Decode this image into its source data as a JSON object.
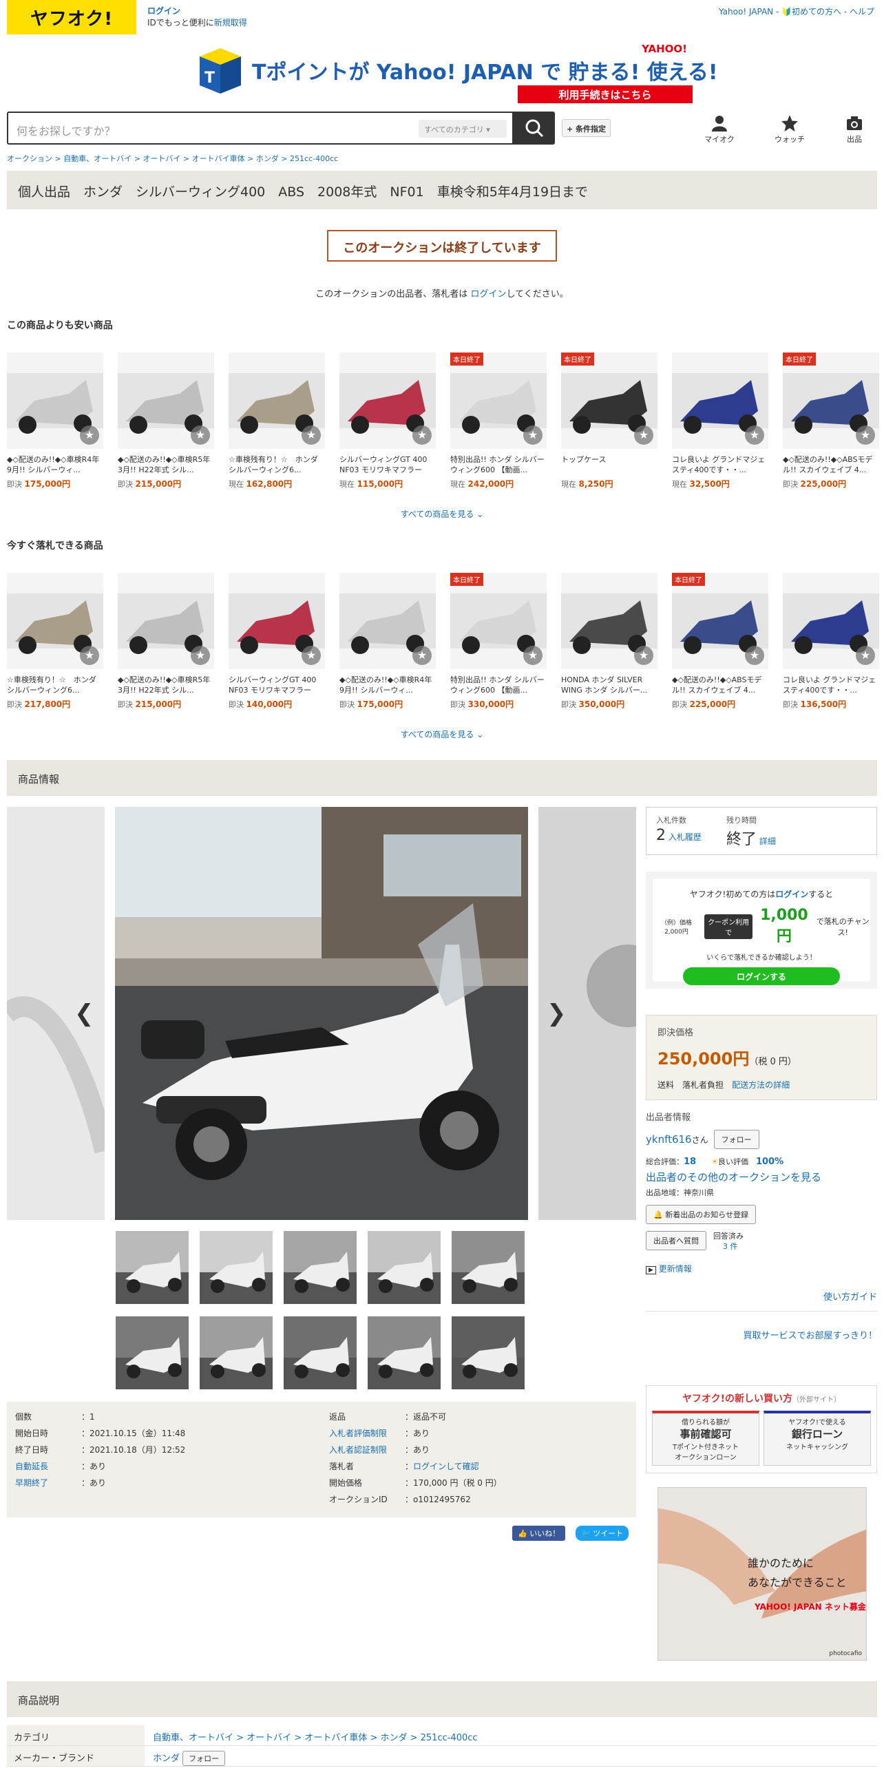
{
  "header": {
    "logo": "ヤフオク!",
    "login": "ログイン",
    "login_sub": "IDでもっと便利に",
    "register": "新規取得",
    "toplinks": "Yahoo! JAPAN - 🔰初めての方へ - ヘルプ",
    "banner_main": "Tポイントが Yahoo! JAPAN で 貯まる! 使える!",
    "banner_sub": "利用手続きはこちら",
    "banner_yahoo": "YAHOO!",
    "search_placeholder": "何をお探しですか？",
    "category_select": "すべてのカテゴリ",
    "conditions": "+ 条件指定",
    "icons": [
      {
        "label": "マイオク"
      },
      {
        "label": "ウォッチ"
      },
      {
        "label": "出品"
      }
    ]
  },
  "breadcrumb": "オークション > 自動車、オートバイ > オートバイ > オートバイ車体 > ホンダ > 251cc-400cc",
  "title": "個人出品　ホンダ　シルバーウィング400　ABS　2008年式　NF01　車検令和5年4月19日まで",
  "ended_notice": "このオークションは終了しています",
  "ended_note_pre": "このオークションの出品者、落札者は",
  "ended_note_link": "ログイン",
  "ended_note_post": "してください。",
  "cheaper": {
    "heading": "この商品よりも安い商品",
    "see_all": "すべての商品を見る",
    "items": [
      {
        "badge": "",
        "title": "◆◇配送のみ!!◆◇車検R4年9月!! シルバーウィ...",
        "ptype": "即決",
        "price": "175,000円",
        "color": "#c9c9c9"
      },
      {
        "badge": "",
        "title": "◆◇配送のみ!!◆◇車検R5年3月!! H22年式 シル...",
        "ptype": "即決",
        "price": "215,000円",
        "color": "#bfbfbf"
      },
      {
        "badge": "",
        "title": "☆車検残有り！☆　ホンダ　シルバーウィング6...",
        "ptype": "現在",
        "price": "162,800円",
        "color": "#a89e8a"
      },
      {
        "badge": "",
        "title": "シルバーウィングGT 400 NF03 モリワキマフラー",
        "ptype": "現在",
        "price": "115,000円",
        "color": "#b8344a"
      },
      {
        "badge": "本日終了",
        "title": "特別出品!! ホンダ シルバーウィング600 【動画...",
        "ptype": "現在",
        "price": "242,000円",
        "color": "#d6d6d6"
      },
      {
        "badge": "本日終了",
        "title": "トップケース",
        "ptype": "現在",
        "price": "8,250円",
        "color": "#333333"
      },
      {
        "badge": "",
        "title": "コレ良いよ グランドマジェスティ400です・・...",
        "ptype": "現在",
        "price": "32,500円",
        "color": "#2e3c8f"
      },
      {
        "badge": "本日終了",
        "title": "◆◇配送のみ!!◆◇ABSモデル!! スカイウェイブ 4...",
        "ptype": "即決",
        "price": "225,000円",
        "color": "#3a4c8c"
      }
    ]
  },
  "buynow": {
    "heading": "今すぐ落札できる商品",
    "see_all": "すべての商品を見る",
    "items": [
      {
        "badge": "",
        "title": "☆車検残有り！☆　ホンダ　シルバーウィング6...",
        "ptype": "即決",
        "price": "217,800円",
        "color": "#a89e8a"
      },
      {
        "badge": "",
        "title": "◆◇配送のみ!!◆◇車検R5年3月!! H22年式 シル...",
        "ptype": "即決",
        "price": "215,000円",
        "color": "#bfbfbf"
      },
      {
        "badge": "",
        "title": "シルバーウィングGT 400 NF03 モリワキマフラー",
        "ptype": "即決",
        "price": "140,000円",
        "color": "#b8344a"
      },
      {
        "badge": "",
        "title": "◆◇配送のみ!!◆◇車検R4年9月!! シルバーウィ...",
        "ptype": "即決",
        "price": "175,000円",
        "color": "#c9c9c9"
      },
      {
        "badge": "本日終了",
        "title": "特別出品!! ホンダ シルバーウィング600 【動画...",
        "ptype": "即決",
        "price": "330,000円",
        "color": "#d6d6d6"
      },
      {
        "badge": "",
        "title": "HONDA ホンダ SILVER WING ホンダ シルバー...",
        "ptype": "即決",
        "price": "350,000円",
        "color": "#4a4a4a"
      },
      {
        "badge": "本日終了",
        "title": "◆◇配送のみ!!◆◇ABSモデル!! スカイウェイブ 4...",
        "ptype": "即決",
        "price": "225,000円",
        "color": "#3a4c8c"
      },
      {
        "badge": "",
        "title": "コレ良いよ グランドマジェスティ400です・・...",
        "ptype": "即決",
        "price": "136,500円",
        "color": "#2e3c8f"
      }
    ]
  },
  "item_info_heading": "商品情報",
  "bid": {
    "count_label": "入札件数",
    "count": "2",
    "history": "入札履歴",
    "time_label": "残り時間",
    "time": "終了",
    "detail": "詳細"
  },
  "promo": {
    "line1": "ヤフオク!初めての方は",
    "login": "ログイン",
    "line1b": "すると",
    "example": "（例）価格2,000円",
    "coupon": "クーポン利用で",
    "amount": "1,000円",
    "chance": "で落札のチャンス!",
    "confirm": "いくらで落札できるか確認しよう！",
    "button": "ログインする"
  },
  "price": {
    "label": "即決価格",
    "value": "250,000円",
    "tax": "（税 0 円）",
    "ship_label": "送料",
    "ship": "落札者負担",
    "ship_link": "配送方法の詳細"
  },
  "seller": {
    "heading": "出品者情報",
    "name": "yknft616",
    "san": "さん",
    "follow": "フォロー",
    "rating_label": "総合評価：",
    "rating": "18",
    "good_label": "良い評価",
    "good": "100%",
    "other": "出品者のその他のオークションを見る",
    "region": "出品地域：神奈川県",
    "notify": "新着出品のお知らせ登録",
    "question": "出品者へ質問",
    "answered": "回答済み",
    "answered_count": "3 件",
    "update": "更新情報",
    "guide": "使い方ガイド",
    "service": "買取サービスでお部屋すっきり！"
  },
  "details_left": [
    {
      "k": "個数",
      "v": "1",
      "link": false
    },
    {
      "k": "開始日時",
      "v": "2021.10.15（金）11:48",
      "link": false
    },
    {
      "k": "終了日時",
      "v": "2021.10.18（月）12:52",
      "link": false
    },
    {
      "k": "自動延長",
      "v": "あり",
      "link": true
    },
    {
      "k": "早期終了",
      "v": "あり",
      "link": true
    }
  ],
  "details_right": [
    {
      "k": "返品",
      "v": "返品不可",
      "link": false,
      "vlink": false
    },
    {
      "k": "入札者評価制限",
      "v": "あり",
      "link": true,
      "vlink": false
    },
    {
      "k": "入札者認証制限",
      "v": "あり",
      "link": true,
      "vlink": false
    },
    {
      "k": "落札者",
      "v": "ログインして確認",
      "link": false,
      "vlink": true
    },
    {
      "k": "開始価格",
      "v": "170,000 円（税 0 円）",
      "link": false,
      "vlink": false
    },
    {
      "k": "オークションID",
      "v": "o1012495762",
      "link": false,
      "vlink": false
    }
  ],
  "social": {
    "like": "いいね！",
    "tweet": "ツイート"
  },
  "newbuy": {
    "title": "ヤフオク!の新しい買い方",
    "ext": "（外部サイト）",
    "c1a": "借りられる額が",
    "c1b": "事前確認可",
    "c1c": "Tポイント付きネット",
    "c1d": "オークションローン",
    "c2a": "ヤフオク!で使える",
    "c2b": "銀行ローン",
    "c2c": "ネットキャッシング"
  },
  "ad": {
    "line1": "誰かのために",
    "line2": "あなたができること",
    "brand": "YAHOO! JAPAN ネット募金",
    "credit": "photocafio"
  },
  "desc_heading": "商品説明",
  "desc_rows": [
    {
      "k": "カテゴリ",
      "v": "自動車、オートバイ > オートバイ > オートバイ車体 > ホンダ > 251cc-400cc"
    },
    {
      "k": "メーカー・ブランド",
      "v": "ホンダ",
      "follow": "フォロー"
    }
  ]
}
